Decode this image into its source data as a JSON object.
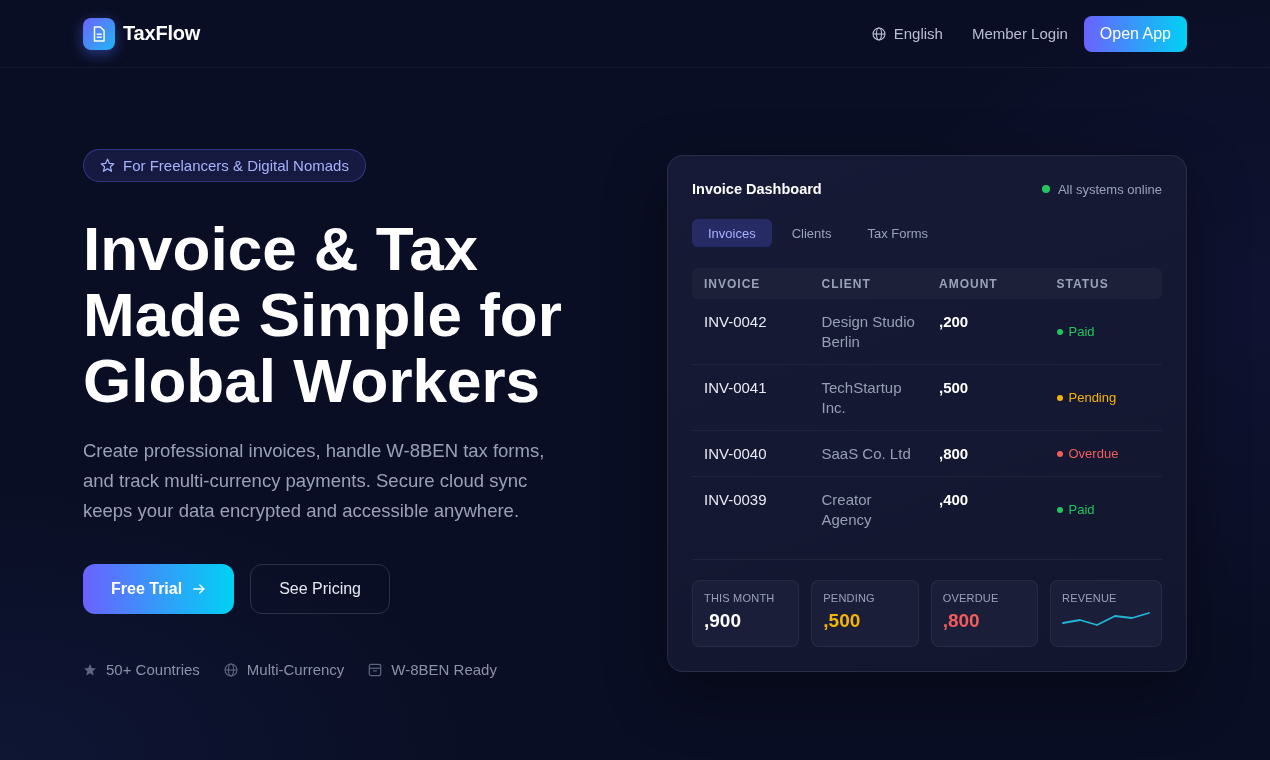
{
  "nav": {
    "brand": "TaxFlow",
    "links": [
      {
        "kind": "language",
        "label": "English"
      },
      {
        "kind": "link",
        "label": "Member Login"
      }
    ],
    "cta": "Open App"
  },
  "hero": {
    "badge": "For Freelancers & Digital Nomads",
    "title": "Invoice & Tax Made Simple for Global Workers",
    "description": "Create professional invoices, handle W-8BEN tax forms, and track multi-currency payments. Secure cloud sync keeps your data encrypted and accessible anywhere.",
    "buttons": [
      {
        "kind": "primary",
        "label": "Free Trial"
      },
      {
        "kind": "secondary",
        "label": "See Pricing"
      }
    ],
    "features": [
      "50+ Countries",
      "Multi-Currency",
      "W-8BEN Ready"
    ]
  },
  "dashboard": {
    "title": "Invoice Dashboard",
    "status": "All systems online",
    "tabs": [
      {
        "label": "Invoices",
        "selected": true
      },
      {
        "label": "Clients",
        "selected": false
      },
      {
        "label": "Tax Forms",
        "selected": false
      }
    ],
    "table": {
      "columns": [
        "INVOICE",
        "CLIENT",
        "AMOUNT",
        "STATUS"
      ],
      "rows": [
        {
          "invoice": "INV-0042",
          "client": "Design Studio Berlin",
          "amount": ",200",
          "status": "Paid",
          "color": "#22c55e"
        },
        {
          "invoice": "INV-0041",
          "client": "TechStartup Inc.",
          "amount": ",500",
          "status": "Pending",
          "color": "#f5b40a"
        },
        {
          "invoice": "INV-0040",
          "client": "SaaS Co. Ltd",
          "amount": ",800",
          "status": "Overdue",
          "color": "#f25c5c"
        },
        {
          "invoice": "INV-0039",
          "client": "Creator Agency",
          "amount": ",400",
          "status": "Paid",
          "color": "#22c55e"
        }
      ]
    },
    "stats": [
      {
        "kind": "value",
        "label": "THIS MONTH",
        "value": ",900",
        "color": "#ffffff"
      },
      {
        "kind": "value",
        "label": "PENDING",
        "value": ",500",
        "color": "#f5b40a"
      },
      {
        "kind": "value",
        "label": "OVERDUE",
        "value": ",800",
        "color": "#f25c5c"
      },
      {
        "kind": "sparkline",
        "label": "REVENUE"
      }
    ]
  }
}
